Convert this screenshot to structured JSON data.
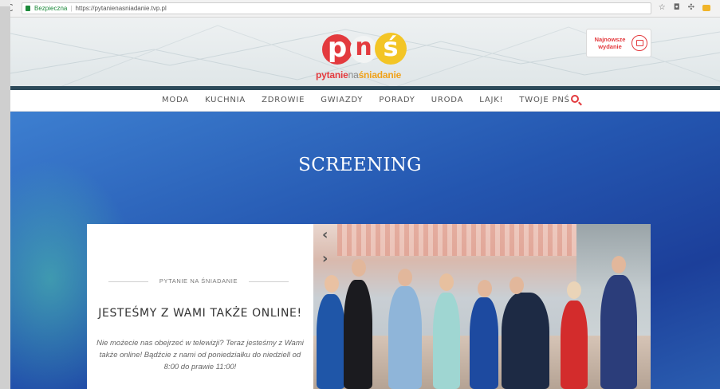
{
  "browser": {
    "secure_label": "Bezpieczna",
    "url": "https://pytanienasniadanie.tvp.pl"
  },
  "header": {
    "logo": {
      "letters": [
        "p",
        "n",
        "ś"
      ],
      "wordmark": [
        "pytanie",
        "na",
        "śniadanie"
      ]
    },
    "newest_button": {
      "label": "Najnowsze wydanie",
      "icon": "calendar-icon"
    }
  },
  "nav": {
    "items": [
      "MODA",
      "KUCHNIA",
      "ZDROWIE",
      "GWIAZDY",
      "PORADY",
      "URODA",
      "LAJK!",
      "TWOJE PNŚ"
    ],
    "search_icon": "search-icon"
  },
  "hero": {
    "title": "SCREENING"
  },
  "card": {
    "kicker": "PYTANIE NA ŚNIADANIE",
    "title": "JESTEŚMY Z WAMI TAKŻE ONLINE!",
    "description": "Nie możecie nas obejrzeć w telewizji? Teraz jesteśmy z Wami także online! Bądźcie z nami od poniedziałku do niedziell od 8:00 do prawie 11:00!"
  },
  "carousel": {
    "prev_icon": "chevron-left-icon",
    "next_icon": "chevron-right-icon"
  },
  "colors": {
    "brand_red": "#e33a3e",
    "brand_yellow": "#f3c526",
    "hero_blue": "#2456b0"
  }
}
